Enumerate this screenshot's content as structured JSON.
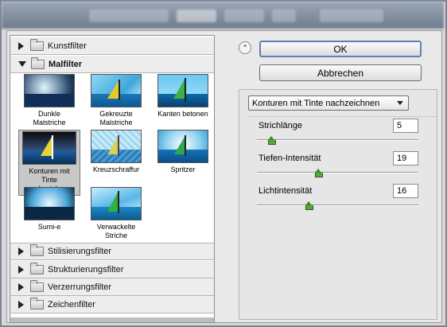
{
  "window": {
    "background_tabs": [
      "Grundelemente",
      "Design",
      "Makro",
      "3D"
    ]
  },
  "filter_tree": {
    "categories_top": [
      {
        "label": "Kunstfilter",
        "expanded": false
      }
    ],
    "open_category": {
      "label": "Malfilter",
      "expanded": true
    },
    "thumbnails": [
      {
        "caption": "Dunkle Malstriche",
        "selected": false
      },
      {
        "caption": "Gekreuzte Malstriche",
        "selected": false
      },
      {
        "caption": "Kanten betonen",
        "selected": false
      },
      {
        "caption": "Konturen mit Tinte nachzeichnen",
        "selected": true
      },
      {
        "caption": "Kreuzschraffur",
        "selected": false
      },
      {
        "caption": "Spritzer",
        "selected": false
      },
      {
        "caption": "Sumi-e",
        "selected": false
      },
      {
        "caption": "Verwackelte Striche",
        "selected": false
      }
    ],
    "categories_bottom": [
      {
        "label": "Stilisierungsfilter",
        "expanded": false
      },
      {
        "label": "Strukturierungsfilter",
        "expanded": false
      },
      {
        "label": "Verzerrungsfilter",
        "expanded": false
      },
      {
        "label": "Zeichenfilter",
        "expanded": false
      }
    ]
  },
  "buttons": {
    "ok": "OK",
    "cancel": "Abbrechen",
    "collapse": "⌃"
  },
  "settings": {
    "filter_select": "Konturen mit Tinte nachzeichnen",
    "params": [
      {
        "label": "Strichlänge",
        "value": "5",
        "fraction": 0.09
      },
      {
        "label": "Tiefen-Intensität",
        "value": "19",
        "fraction": 0.38
      },
      {
        "label": "Lichtintensität",
        "value": "16",
        "fraction": 0.32
      }
    ]
  },
  "colors": {
    "accent": "#5e7fb8",
    "slider_knob": "#56a63f"
  }
}
